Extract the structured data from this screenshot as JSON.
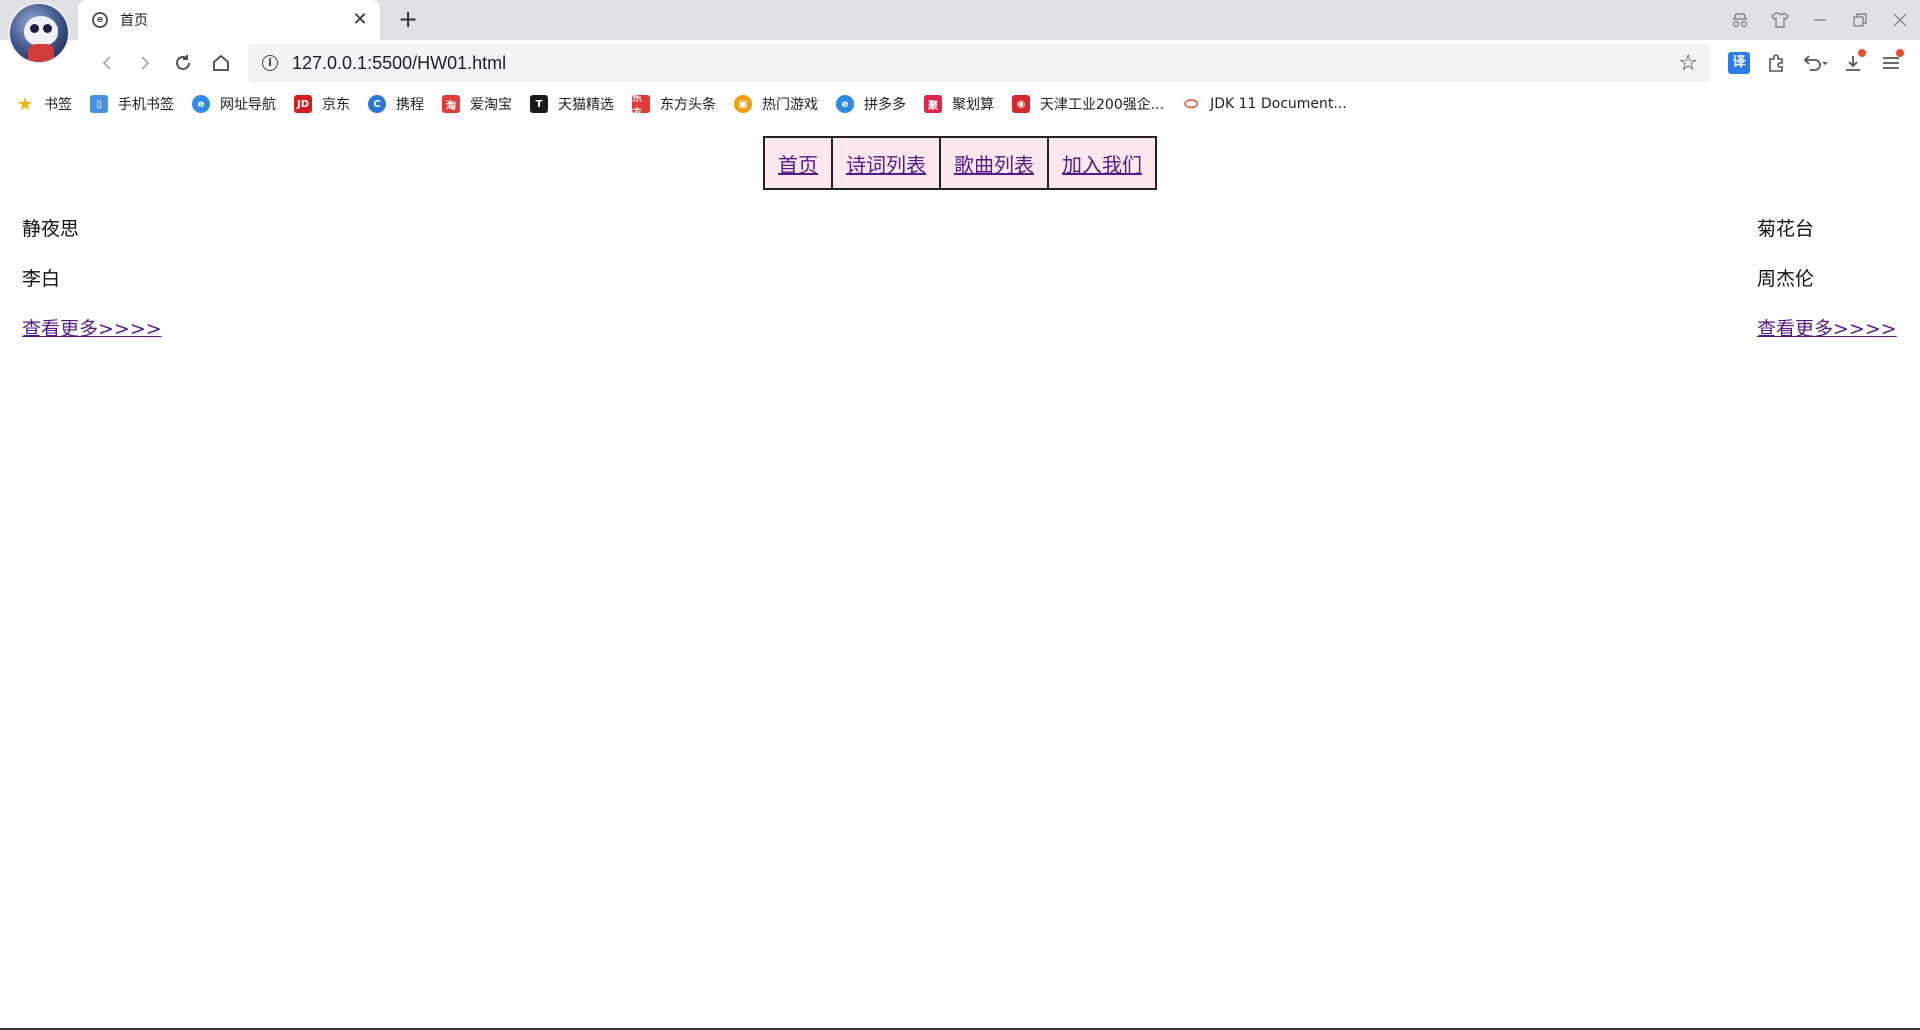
{
  "browser": {
    "tab_title": "首页",
    "tab_favicon": "e",
    "url": "127.0.0.1:5500/HW01.html",
    "translate_label": "译",
    "bookmarks": [
      {
        "label": "书签",
        "icon": "star-icon",
        "color": "#f5b400",
        "glyph": "★"
      },
      {
        "label": "手机书签",
        "icon": "phone-icon",
        "color": "#4a90e2",
        "glyph": "▯"
      },
      {
        "label": "网址导航",
        "icon": "browser-e-icon",
        "color": "#2d8ae8",
        "glyph": "e"
      },
      {
        "label": "京东",
        "icon": "jd-icon",
        "color": "#d71c1e",
        "glyph": "JD"
      },
      {
        "label": "携程",
        "icon": "ctrip-icon",
        "color": "#2878d6",
        "glyph": "C"
      },
      {
        "label": "爱淘宝",
        "icon": "taobao-icon",
        "color": "#e23b3b",
        "glyph": "淘"
      },
      {
        "label": "天猫精选",
        "icon": "tmall-icon",
        "color": "#1a1a1a",
        "glyph": "T"
      },
      {
        "label": "东方头条",
        "icon": "dongfang-icon",
        "color": "#e53935",
        "glyph": "东方"
      },
      {
        "label": "热门游戏",
        "icon": "game-icon",
        "color": "#f39c12",
        "glyph": "▣"
      },
      {
        "label": "拼多多",
        "icon": "browser-e-icon",
        "color": "#2d8ae8",
        "glyph": "e"
      },
      {
        "label": "聚划算",
        "icon": "juhuasuan-icon",
        "color": "#e0244a",
        "glyph": "聚"
      },
      {
        "label": "天津工业200强企...",
        "icon": "weibo-icon",
        "color": "#d8262d",
        "glyph": "◉"
      },
      {
        "label": "JDK 11 Document...",
        "icon": "oracle-icon",
        "color": "#e74c3c",
        "glyph": "⬭"
      }
    ]
  },
  "page": {
    "nav": [
      "首页",
      "诗词列表",
      "歌曲列表",
      "加入我们"
    ],
    "left": {
      "title": "静夜思",
      "author": "李白",
      "more": "查看更多>>>>"
    },
    "right": {
      "title": "菊花台",
      "author": "周杰伦",
      "more": "查看更多>>>>"
    }
  }
}
